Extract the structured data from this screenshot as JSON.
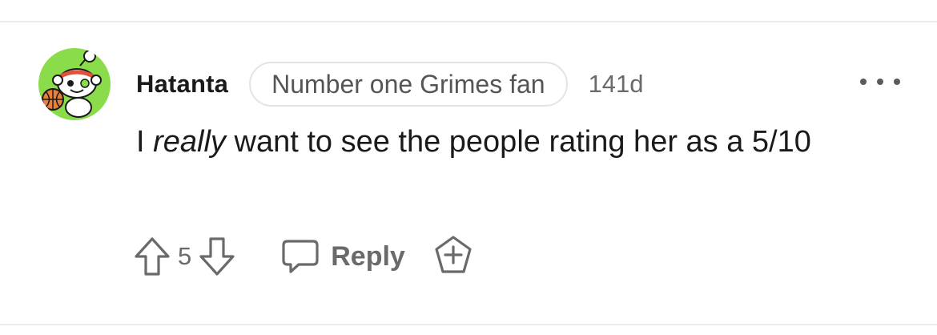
{
  "comment": {
    "username": "Hatanta",
    "flair": "Number one Grimes fan",
    "age": "141d",
    "body": {
      "prefix": "I ",
      "emphasis": "really",
      "suffix": " want to see the people rating her as a 5/10"
    },
    "votes": "5",
    "reply_label": "Reply"
  },
  "icons": {
    "avatar": "reddit-snoo-avatar-icon",
    "more": "ellipsis-icon",
    "upvote": "arrow-up-icon",
    "downvote": "arrow-down-icon",
    "reply": "speech-bubble-icon",
    "award": "award-plus-icon"
  },
  "colors": {
    "avatar_bg": "#8bdc4a",
    "text": "#1a1a1b",
    "muted": "#6a6a6a",
    "flair_border": "#e4e4e4"
  }
}
